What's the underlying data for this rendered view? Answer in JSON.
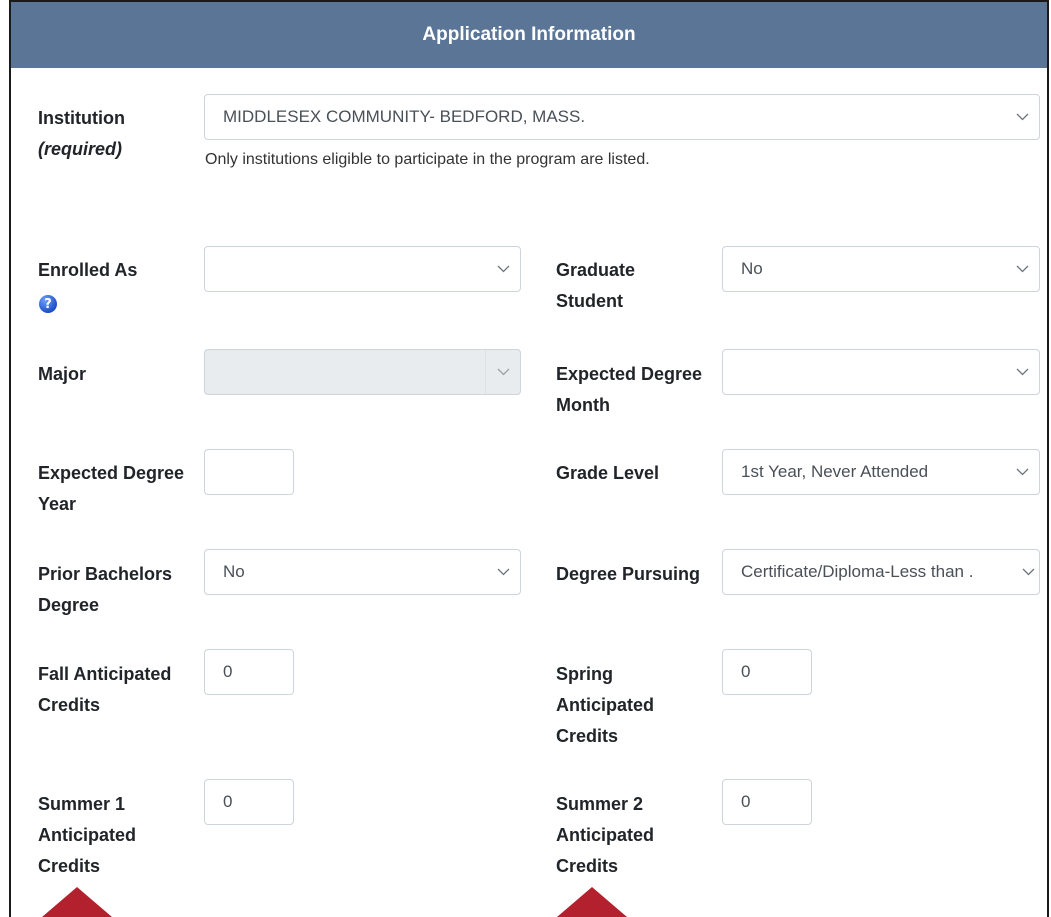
{
  "header": {
    "title": "Application Information"
  },
  "institution": {
    "label": "Institution",
    "required_label": "(required)",
    "value": "MIDDLESEX COMMUNITY- BEDFORD, MASS.",
    "help": "Only institutions eligible to participate in the program are listed."
  },
  "enrolled_as": {
    "label": "Enrolled As",
    "value": ""
  },
  "graduate_student": {
    "label_line1": "Graduate",
    "label_line2": "Student",
    "value": "No"
  },
  "major": {
    "label": "Major",
    "value": ""
  },
  "expected_degree_month": {
    "label_line1": "Expected Degree",
    "label_line2": "Month",
    "value": ""
  },
  "expected_degree_year": {
    "label_line1": "Expected Degree",
    "label_line2": "Year",
    "value": ""
  },
  "grade_level": {
    "label": "Grade Level",
    "value": "1st Year, Never Attended"
  },
  "prior_bachelors": {
    "label_line1": "Prior Bachelors",
    "label_line2": "Degree",
    "value": "No"
  },
  "degree_pursuing": {
    "label": "Degree Pursuing",
    "value": "Certificate/Diploma-Less than ."
  },
  "fall_credits": {
    "label_line1": "Fall Anticipated",
    "label_line2": "Credits",
    "value": "0"
  },
  "spring_credits": {
    "label_line1": "Spring",
    "label_line2": "Anticipated",
    "label_line3": "Credits",
    "value": "0"
  },
  "summer1_credits": {
    "label_line1": "Summer 1",
    "label_line2": "Anticipated",
    "label_line3": "Credits",
    "value": "0"
  },
  "summer2_credits": {
    "label_line1": "Summer 2",
    "label_line2": "Anticipated",
    "label_line3": "Credits",
    "value": "0"
  },
  "colors": {
    "header_bg": "#5b7596",
    "arrow": "#b3212e",
    "help_icon": "#1f4fc4"
  },
  "icons": {
    "dropdown": "chevron-down-icon",
    "help": "question-icon",
    "annotation": "red-arrow"
  }
}
